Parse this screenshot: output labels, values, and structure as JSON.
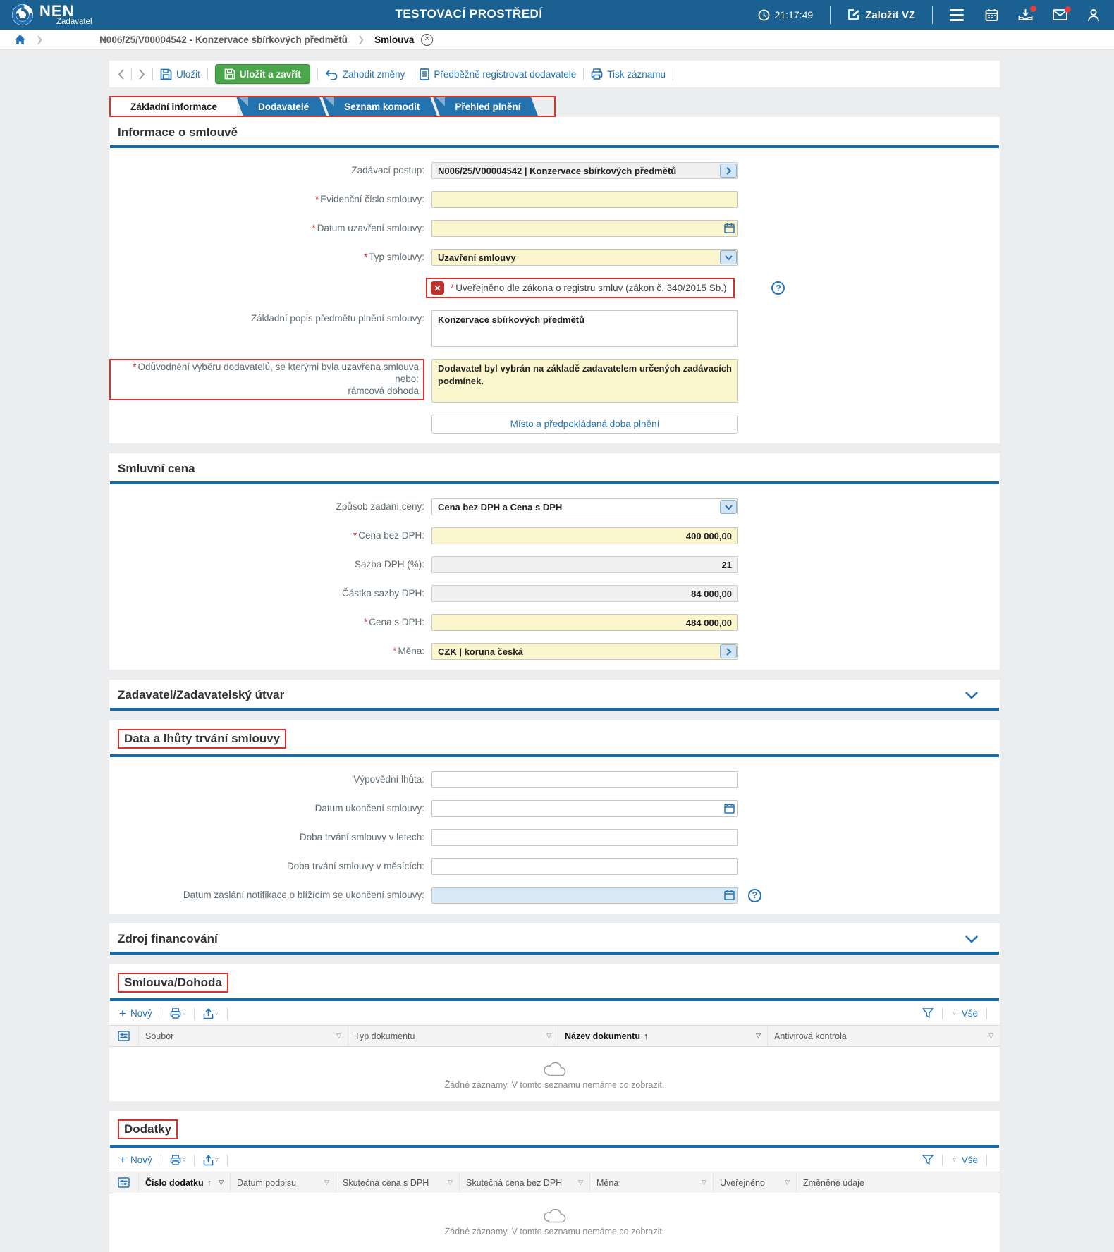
{
  "topbar": {
    "brand": "NEN",
    "role": "Zadavatel",
    "environment": "TESTOVACÍ PROSTŘEDÍ",
    "time": "21:17:49",
    "create_vz": "Založit VZ"
  },
  "breadcrumb": {
    "procedure": "N006/25/V00004542 - Konzervace sbírkových předmětů",
    "current": "Smlouva"
  },
  "actionbar": {
    "save": "Uložit",
    "save_close": "Uložit a zavřít",
    "discard": "Zahodit změny",
    "preregister": "Předběžně registrovat dodavatele",
    "print": "Tisk záznamu"
  },
  "tabs": [
    {
      "label": "Základní informace",
      "active": true
    },
    {
      "label": "Dodavatelé",
      "active": false
    },
    {
      "label": "Seznam komodit",
      "active": false
    },
    {
      "label": "Přehled plnění",
      "active": false
    }
  ],
  "list_toolbar": {
    "new_label": "Nový",
    "all_label": "Vše"
  },
  "sections": {
    "info": {
      "title": "Informace o smlouvě",
      "zadavaci_postup_label": "Zadávací postup:",
      "zadavaci_postup_value": "N006/25/V00004542 | Konzervace sbírkových předmětů",
      "evidencni_label": "Evidenční číslo smlouvy:",
      "datum_uzavreni_label": "Datum uzavření smlouvy:",
      "typ_label": "Typ smlouvy:",
      "typ_value": "Uzavření smlouvy",
      "uverejneno_text": "Uveřejněno dle zákona o registru smluv (zákon č. 340/2015 Sb.)",
      "popis_label": "Základní popis předmětu plnění smlouvy:",
      "popis_value": "Konzervace sbírkových předmětů",
      "oduvodneni_line1": "Odůvodnění výběru dodavatelů, se kterými byla uzavřena smlouva nebo:",
      "oduvodneni_line2": "rámcová dohoda",
      "oduvodneni_value": "Dodavatel byl vybrán na základě zadavatelem určených zadávacích podmínek.",
      "misto_button": "Místo a předpokládaná doba plnění"
    },
    "cena": {
      "title": "Smluvní cena",
      "zpusob_label": "Způsob zadání ceny:",
      "zpusob_value": "Cena bez DPH a Cena s DPH",
      "cena_bez_label": "Cena bez DPH:",
      "cena_bez_value": "400 000,00",
      "sazba_label": "Sazba DPH (%):",
      "sazba_value": "21",
      "castka_label": "Částka sazby DPH:",
      "castka_value": "84 000,00",
      "cena_s_label": "Cena s DPH:",
      "cena_s_value": "484 000,00",
      "mena_label": "Měna:",
      "mena_value": "CZK | koruna česká"
    },
    "zadavatel": {
      "title": "Zadavatel/Zadavatelský útvar"
    },
    "data_lhuty": {
      "title": "Data a lhůty trvání smlouvy",
      "vypovedni_label": "Výpovědní lhůta:",
      "datum_ukonceni_label": "Datum ukončení smlouvy:",
      "doba_let_label": "Doba trvání smlouvy v letech:",
      "doba_mesicu_label": "Doba trvání smlouvy v měsících:",
      "notifikace_label": "Datum zaslání notifikace o blížícím se ukončení smlouvy:"
    },
    "zdroj": {
      "title": "Zdroj financování"
    },
    "smlouva_dohoda": {
      "title": "Smlouva/Dohoda",
      "columns": [
        "Soubor",
        "Typ dokumentu",
        "Název dokumentu",
        "Antivirová kontrola"
      ],
      "empty_text": "Žádné záznamy. V tomto seznamu nemáme co zobrazit."
    },
    "dodatky": {
      "title": "Dodatky",
      "columns": [
        "Číslo dodatku",
        "Datum podpisu",
        "Skutečná cena s DPH",
        "Skutečná cena bez DPH",
        "Měna",
        "Uveřejněno",
        "Změněné údaje"
      ],
      "empty_text": "Žádné záznamy. V tomto seznamu nemáme co zobrazit."
    }
  },
  "colors": {
    "topbar_blue": "#1A6191",
    "tab_blue": "#2273AE",
    "section_rule_blue": "#1769A8",
    "link_blue": "#2273B8",
    "green_button": "#4BA64B",
    "required_yellow": "#FCF6CE",
    "readonly_gray": "#F0F0F1",
    "notification_blue_field": "#D9EAF6",
    "annotation_red": "#D9342B",
    "error_icon_red": "#C4302B"
  }
}
